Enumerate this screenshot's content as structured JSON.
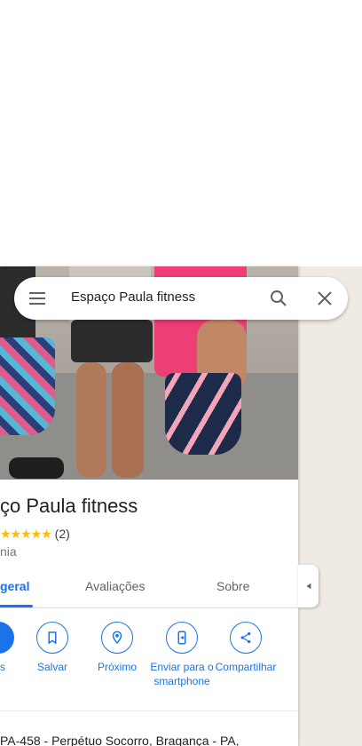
{
  "search": {
    "query": "Espaço Paula fitness"
  },
  "place": {
    "title": "ço Paula fitness",
    "rating_count": "(2)",
    "category": "nia",
    "address": "PA-458 - Perpétuo Socorro, Bragança - PA,"
  },
  "tabs": [
    {
      "label": "geral"
    },
    {
      "label": "Avaliações"
    },
    {
      "label": "Sobre"
    }
  ],
  "actions": [
    {
      "label": "s",
      "icon": "directions-icon"
    },
    {
      "label": "Salvar",
      "icon": "bookmark-icon"
    },
    {
      "label": "Próximo",
      "icon": "nearby-icon"
    },
    {
      "label": "Enviar para o smartphone",
      "icon": "send-to-phone-icon"
    },
    {
      "label": "Compartilhar",
      "icon": "share-icon"
    }
  ],
  "colors": {
    "accent": "#1a73e8",
    "star": "#fbbc04"
  }
}
